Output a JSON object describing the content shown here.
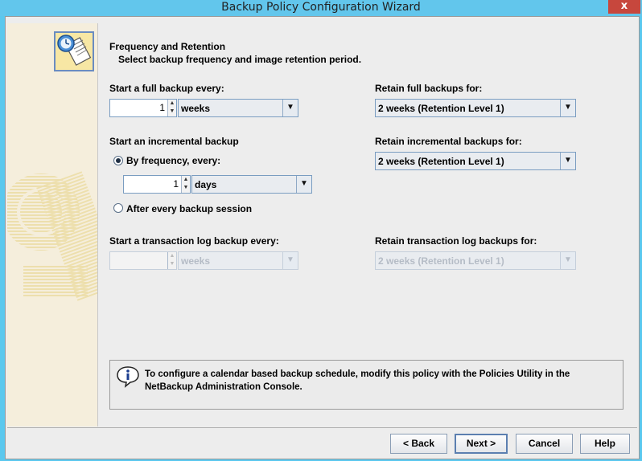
{
  "window": {
    "title": "Backup Policy Configuration Wizard",
    "close_glyph": "x"
  },
  "header": {
    "title": "Frequency and Retention",
    "subtitle": "Select backup frequency and image retention period."
  },
  "full_backup": {
    "label": "Start a full backup every:",
    "value": "1",
    "unit": "weeks",
    "retain_label": "Retain full backups for:",
    "retain_value": "2 weeks (Retention Level 1)"
  },
  "incremental": {
    "label": "Start an incremental backup",
    "by_frequency_label": "By frequency, every:",
    "by_frequency_selected": true,
    "value": "1",
    "unit": "days",
    "after_session_label": "After every backup session",
    "after_session_selected": false,
    "retain_label": "Retain incremental backups for:",
    "retain_value": "2 weeks (Retention Level 1)"
  },
  "transaction_log": {
    "label": "Start a transaction log backup every:",
    "value": "",
    "unit": "weeks",
    "enabled": false,
    "retain_label": "Retain transaction log backups for:",
    "retain_value": "2 weeks (Retention Level 1)"
  },
  "info": {
    "text": "To configure a calendar based backup schedule, modify this policy with the Policies Utility in the NetBackup Administration Console."
  },
  "buttons": {
    "back": "< Back",
    "next": "Next >",
    "cancel": "Cancel",
    "help": "Help"
  },
  "icons": {
    "wizard_logo": "policy-clock-document-icon",
    "info": "info-bubble-icon",
    "spinner_up": "▲",
    "spinner_down": "▼",
    "dropdown": "▼"
  },
  "colors": {
    "titlebar": "#62c6ec",
    "close": "#c7473d",
    "panel": "#ededed",
    "sidebar": "#f5eedc"
  }
}
